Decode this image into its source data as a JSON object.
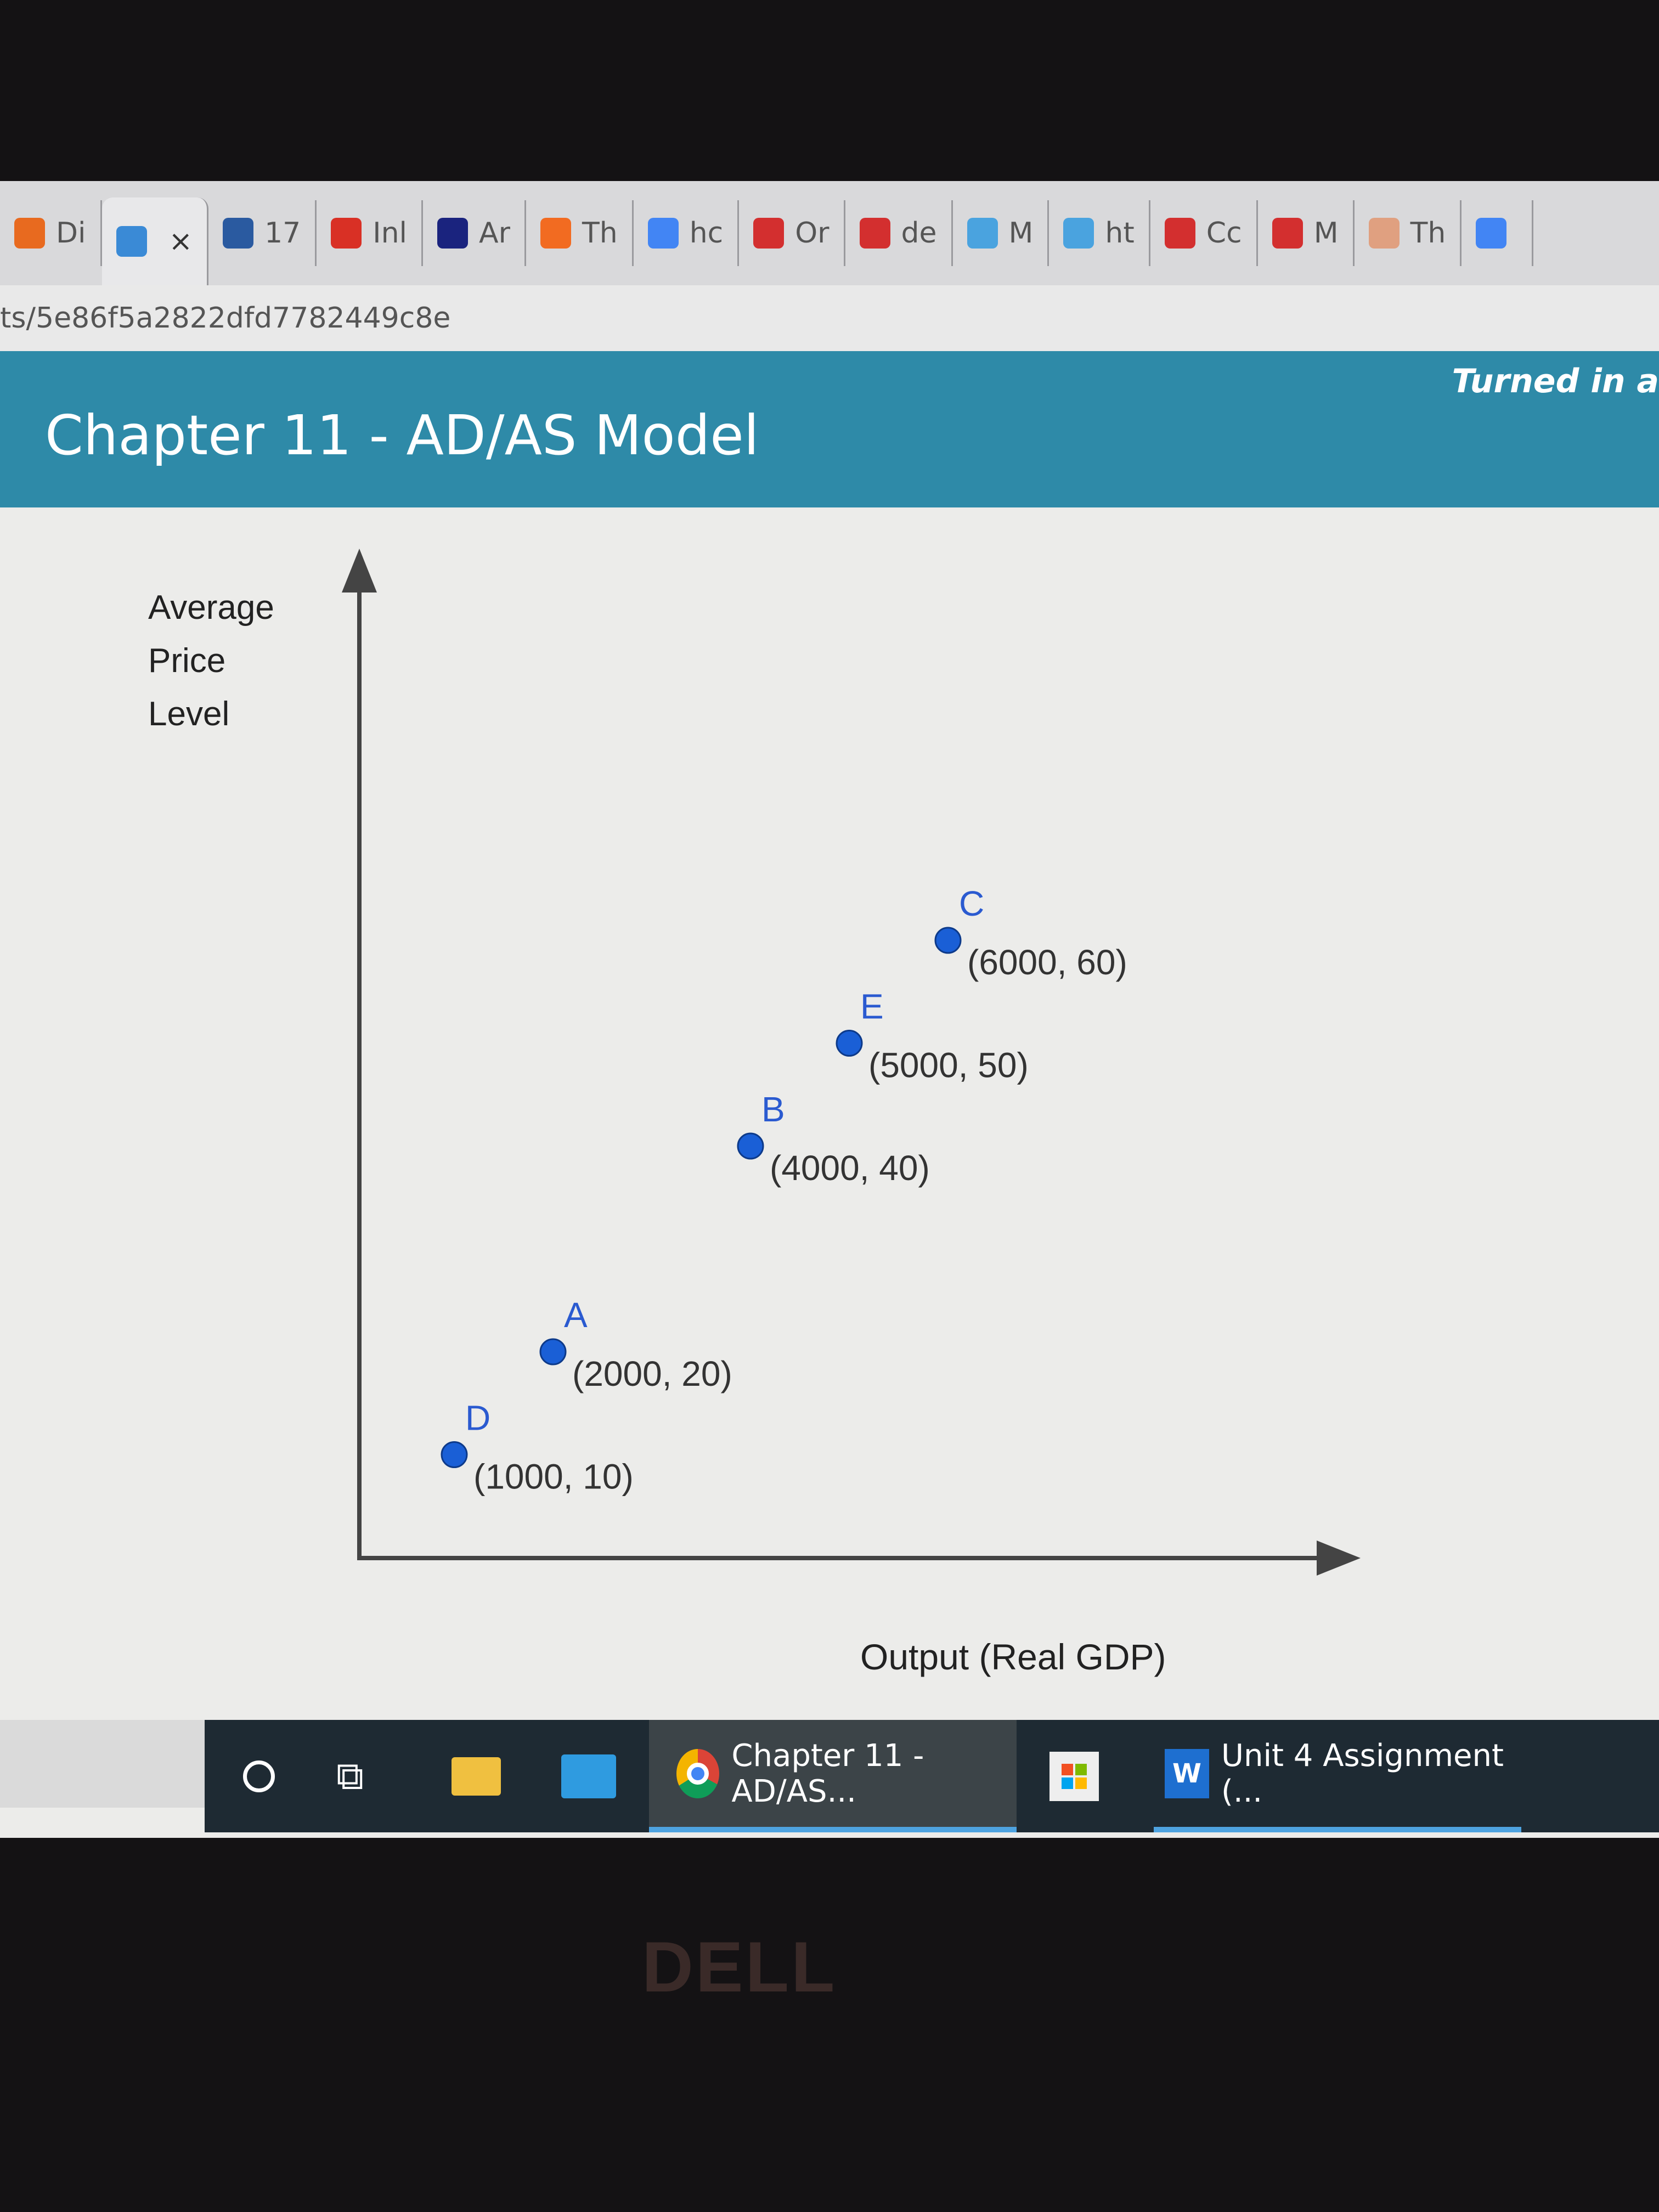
{
  "browser": {
    "tabs": [
      {
        "label": "Di",
        "icon": "orange-circle-icon",
        "color": "#e86a1f"
      },
      {
        "label": "",
        "icon": "infinity-icon",
        "close": "×",
        "color": "#3a8ad6",
        "active": true
      },
      {
        "label": "17",
        "icon": "gem-icon",
        "color": "#2a5aa0"
      },
      {
        "label": "Inl",
        "icon": "gmail-icon",
        "color": "#d93025"
      },
      {
        "label": "Ar",
        "icon": "bing-b-icon",
        "color": "#1a237e"
      },
      {
        "label": "Th",
        "icon": "home-depot-icon",
        "color": "#f26b21"
      },
      {
        "label": "hc",
        "icon": "google-g-icon",
        "color": "#4285f4"
      },
      {
        "label": "Or",
        "icon": "c-icon",
        "color": "#d32f2f"
      },
      {
        "label": "de",
        "icon": "c-icon",
        "color": "#d32f2f"
      },
      {
        "label": "M",
        "icon": "dots-icon",
        "color": "#4aa3df"
      },
      {
        "label": "ht",
        "icon": "hexagon-icon",
        "color": "#4aa3df"
      },
      {
        "label": "Cc",
        "icon": "mcgraw-hill-icon",
        "color": "#d32f2f"
      },
      {
        "label": "M",
        "icon": "m-icon",
        "color": "#d32f2f"
      },
      {
        "label": "Th",
        "icon": "person-icon",
        "color": "#e0a080"
      },
      {
        "label": "",
        "icon": "google-g-icon",
        "color": "#4285f4"
      }
    ],
    "url": "ts/5e86f5a2822dfd7782449c8e"
  },
  "header": {
    "title": "Chapter 11 - AD/AS Model",
    "status": "Turned in a",
    "color": "#2e8aa8"
  },
  "chart_data": {
    "type": "scatter",
    "ylabel_lines": [
      "Average",
      "Price",
      "Level"
    ],
    "xlabel": "Output (Real GDP)",
    "xlim": [
      0,
      13000
    ],
    "ylim": [
      0,
      98
    ],
    "grid": false,
    "point_color": "#1a5fd6",
    "points": [
      {
        "name": "C",
        "x": 6000,
        "y": 60,
        "label": "(6000, 60)"
      },
      {
        "name": "E",
        "x": 5000,
        "y": 50,
        "label": "(5000, 50)"
      },
      {
        "name": "B",
        "x": 4000,
        "y": 40,
        "label": "(4000, 40)"
      },
      {
        "name": "A",
        "x": 2000,
        "y": 20,
        "label": "(2000, 20)"
      },
      {
        "name": "D",
        "x": 1000,
        "y": 10,
        "label": "(1000, 10)"
      }
    ]
  },
  "taskbar": {
    "chrome_label": "Chapter 11 - AD/AS...",
    "word_label": "Unit 4 Assignment (...",
    "word_letter": "W"
  },
  "bezel": {
    "logo": "DELL"
  }
}
